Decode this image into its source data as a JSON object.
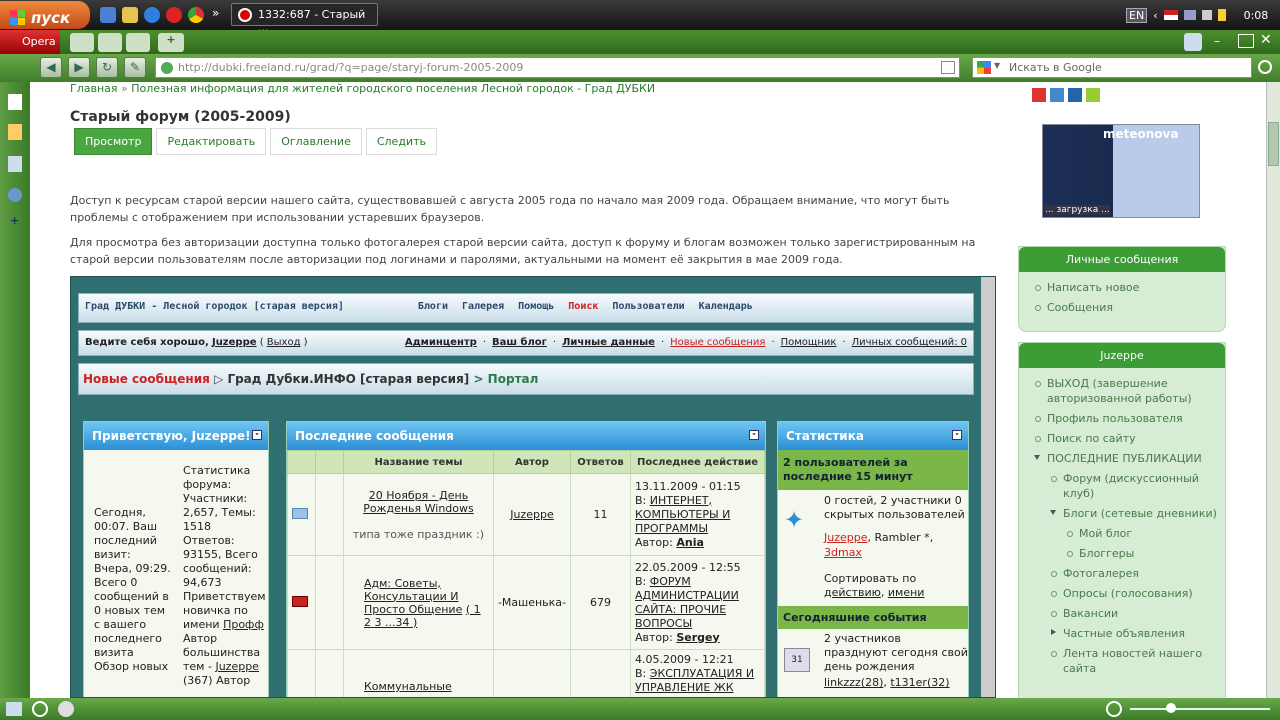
{
  "taskbar": {
    "start_label": "пуск",
    "task_title": "1332:687 - Старый ...",
    "chevron": "»",
    "lang": "EN",
    "clock": "0:08"
  },
  "opera": {
    "menu_label": "Opera",
    "url": "http://dubki.freeland.ru/grad/?q=page/staryj-forum-2005-2009",
    "search_placeholder": "Искать в Google"
  },
  "page": {
    "breadcrumb_home": "Главная",
    "breadcrumb_sep": "»",
    "breadcrumb_section": "Полезная информация для жителей городского поселения Лесной городок - Град ДУБКИ",
    "title": "Старый форум (2005-2009)",
    "tabs": [
      "Просмотр",
      "Редактировать",
      "Оглавление",
      "Следить"
    ],
    "para1": "Доступ к ресурсам старой версии нашего сайта, существовавшей с августа 2005 года по начало мая 2009 года. Обращаем внимание, что могут быть проблемы с отображением при использовании устаревших браузеров.",
    "para2": "Для просмотра без авторизации доступна только фотогалерея старой версии сайта, доступ к форуму и блогам возможен только зарегистрированным на старой версии пользователям после авторизации под логинами и паролями, актуальными на момент её закрытия в мае 2009 года."
  },
  "forum": {
    "site_title": "Град ДУБКИ - Лесной городок [старая версия]",
    "nav": [
      "Блоги",
      "Галерея",
      "Помощь",
      "Поиск",
      "Пользователи",
      "Календарь"
    ],
    "welcome": "Ведите себя хорошо,",
    "user": "Juzeppe",
    "logout": "Выход",
    "user_links": [
      "Админцентр",
      "Ваш блог",
      "Личные данные",
      "Новые сообщения",
      "Помощник",
      "Личных сообщений: 0"
    ],
    "crumb_new": "Новые сообщения",
    "crumb_forum": "Град Дубки.ИНФО [старая версия]",
    "crumb_portal": "> Портал",
    "greet_head": "Приветствую, Juzeppe!",
    "greet_left": "Сегодня, 00:07. Ваш последний визит: Вчера, 09:29. Всего 0 сообщений в 0 новых тем с вашего последнего визита Обзор новых",
    "greet_right_1": "Статистика форума: Участники: 2,657, Темы: 1518 Ответов: 93155, Всего сообщений: 94,673 Приветствуем новичка по имени",
    "greet_right_newbie": "Профф",
    "greet_right_2": "Автор большинства тем -",
    "greet_right_author": "Juzeppe",
    "greet_right_3": "(367) Автор",
    "posts_head": "Последние сообщения",
    "cols": [
      "Название темы",
      "Автор",
      "Ответов",
      "Последнее действие"
    ],
    "rows": [
      {
        "topic": "20 Ноября - День Рожденья Windows",
        "sub": "типа тоже праздник :)",
        "author": "Juzeppe",
        "replies": "11",
        "date": "13.11.2009 - 01:15",
        "in_prefix": "В:",
        "in": "ИНТЕРНЕТ, КОМПЬЮТЕРЫ И ПРОГРАММЫ",
        "by_prefix": "Автор:",
        "by": "Ania"
      },
      {
        "topic": "Адм: Советы, Консультации И Просто Общение",
        "pages": "( 1 2 3 ...34 )",
        "author": "-Машенька-",
        "replies": "679",
        "date": "22.05.2009 - 12:55",
        "in_prefix": "В:",
        "in": "ФОРУМ АДМИНИСТРАЦИИ САЙТА: ПРОЧИЕ ВОПРОСЫ",
        "by_prefix": "Автор:",
        "by": "Sergey"
      },
      {
        "topic": "Коммунальные услуги",
        "author": "",
        "replies": "",
        "date": "4.05.2009 - 12:21",
        "in_prefix": "В:",
        "in": "ЭКСПЛУАТАЦИЯ И УПРАВЛЕНИЕ ЖК",
        "by_prefix": "",
        "by": ""
      }
    ],
    "stats_head": "Статистика",
    "stats_online_head": "2 пользователей за последние 15 минут",
    "stats_online": "0 гостей, 2 участники 0 скрытых пользователей",
    "stats_users": [
      "Juzeppe",
      "Rambler *",
      "3dmax"
    ],
    "stats_sort": "Сортировать по",
    "stats_sort_by": [
      "действию",
      "имени"
    ],
    "events_head": "Сегодняшние события",
    "events_text": "2 участников празднуют сегодня свой день рождения",
    "events_users": [
      "linkzzz(28)",
      "t131er(32)"
    ]
  },
  "sidebar": {
    "meteo_loading": "... загрузка ...",
    "meteo_logo": "meteonova",
    "pm_head": "Личные сообщения",
    "pm_items": [
      "Написать новое",
      "Сообщения"
    ],
    "user_head": "Juzeppe",
    "user_items": [
      {
        "label": "ВЫХОД (завершение авторизованной работы)",
        "lvl": 0
      },
      {
        "label": "Профиль пользователя",
        "lvl": 0
      },
      {
        "label": "Поиск по сайту",
        "lvl": 0
      },
      {
        "label": "ПОСЛЕДНИЕ ПУБЛИКАЦИИ",
        "lvl": 0,
        "open": true
      },
      {
        "label": "Форум (дискуссионный клуб)",
        "lvl": 1
      },
      {
        "label": "Блоги (сетевые дневники)",
        "lvl": 1,
        "open": true
      },
      {
        "label": "Мой блог",
        "lvl": 2
      },
      {
        "label": "Блоггеры",
        "lvl": 2
      },
      {
        "label": "Фотогалерея",
        "lvl": 1
      },
      {
        "label": "Опросы (голосования)",
        "lvl": 1
      },
      {
        "label": "Вакансии",
        "lvl": 1
      },
      {
        "label": "Частные объявления",
        "lvl": 1,
        "closed": true
      },
      {
        "label": "Лента новостей нашего сайта",
        "lvl": 1
      }
    ]
  },
  "colors": {
    "accent": "#3c9c36",
    "forum_blue": "#2c8fd4",
    "link": "#2a7a2a"
  }
}
